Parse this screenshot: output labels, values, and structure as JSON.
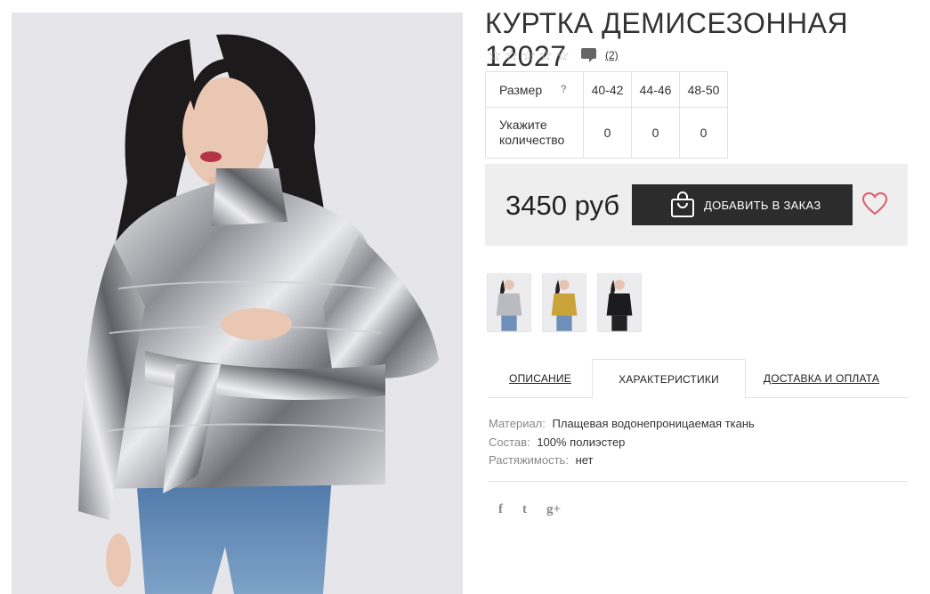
{
  "product": {
    "title": "КУРТКА ДЕМИСЕЗОННАЯ 12027",
    "rating_stars": 0,
    "reviews_count": "(2)"
  },
  "sizes": {
    "header_label": "Размер",
    "help_glyph": "?",
    "columns": [
      "40-42",
      "44-46",
      "48-50"
    ],
    "quantity_label": "Укажите количество",
    "quantities": [
      "0",
      "0",
      "0"
    ]
  },
  "buy": {
    "price": "3450 руб",
    "add_to_order_label": "ДОБАВИТЬ В ЗАКАЗ"
  },
  "thumbnails": [
    "silver",
    "gold",
    "black"
  ],
  "tabs": [
    {
      "label": "ОПИСАНИЕ",
      "active": false
    },
    {
      "label": "ХАРАКТЕРИСТИКИ",
      "active": true
    },
    {
      "label": "ДОСТАВКА И ОПЛАТА",
      "active": false
    }
  ],
  "specs": [
    {
      "key": "Материал:",
      "value": "Плащевая водонепроницаемая ткань"
    },
    {
      "key": "Состав:",
      "value": "100% полиэстер"
    },
    {
      "key": "Растяжимость:",
      "value": "нет"
    }
  ],
  "social": {
    "facebook": "f",
    "twitter": "t",
    "google_plus": "g+"
  },
  "colors": {
    "button_bg": "#2c2c2c",
    "buybox_bg": "#eeeeee",
    "heart": "#e05a6a"
  }
}
